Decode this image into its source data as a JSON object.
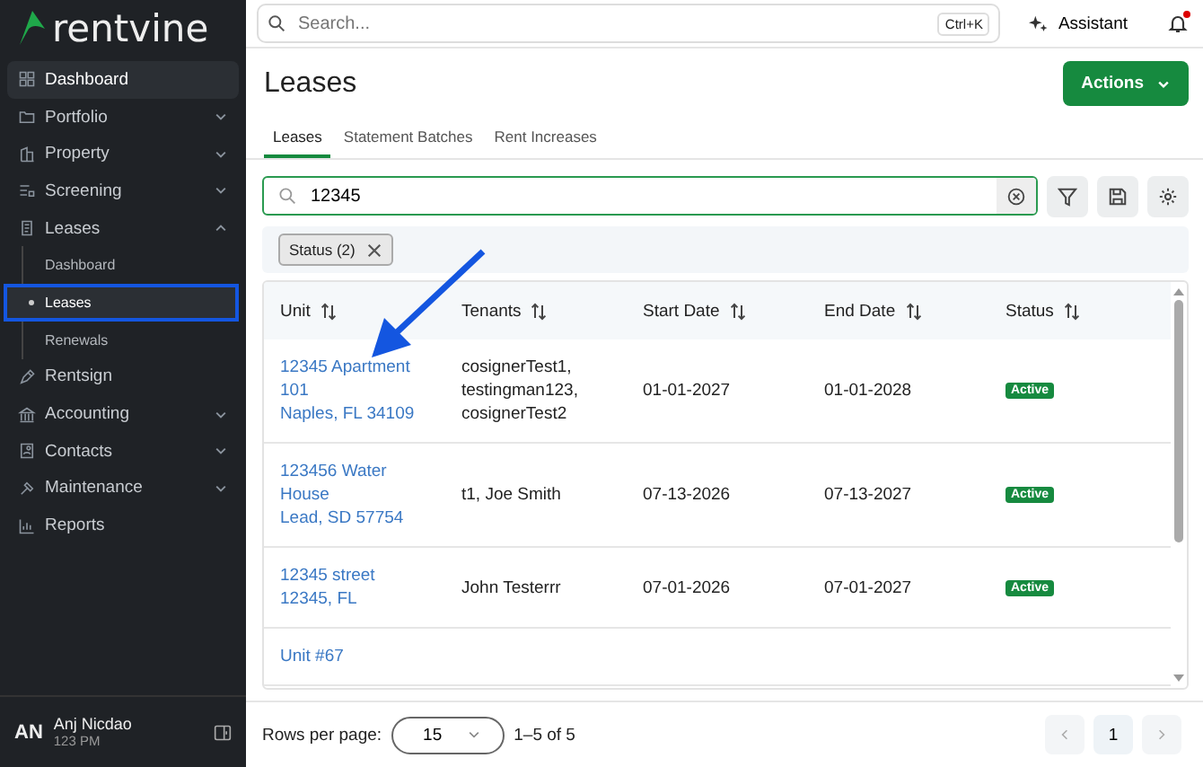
{
  "logo": "rentvine",
  "sidebar": {
    "items": [
      {
        "label": "Dashboard",
        "selected": true
      },
      {
        "label": "Portfolio",
        "selected": false,
        "expanded": false
      },
      {
        "label": "Property",
        "selected": false,
        "expanded": false
      },
      {
        "label": "Screening",
        "selected": false,
        "expanded": false
      },
      {
        "label": "Leases",
        "selected": false,
        "expanded": true,
        "children": [
          {
            "label": "Dashboard",
            "selected": false,
            "highlighted": false
          },
          {
            "label": "Leases",
            "selected": true,
            "highlighted": true
          },
          {
            "label": "Renewals",
            "selected": false,
            "highlighted": false
          }
        ]
      },
      {
        "label": "Rentsign",
        "selected": false
      },
      {
        "label": "Accounting",
        "selected": false,
        "expanded": false
      },
      {
        "label": "Contacts",
        "selected": false,
        "expanded": false
      },
      {
        "label": "Maintenance",
        "selected": false,
        "expanded": false
      },
      {
        "label": "Reports",
        "selected": false
      }
    ]
  },
  "user": {
    "initials": "AN",
    "name": "Anj Nicdao",
    "subtitle": "123 PM"
  },
  "topbar": {
    "search_placeholder": "Search...",
    "shortcut": "Ctrl+K",
    "assistant": "Assistant",
    "unread": true
  },
  "page": {
    "title": "Leases",
    "actions": "Actions"
  },
  "tabs": [
    {
      "label": "Leases",
      "selected": true
    },
    {
      "label": "Statement Batches",
      "selected": false
    },
    {
      "label": "Rent Increases",
      "selected": false
    }
  ],
  "search": {
    "value": "12345"
  },
  "filters": [
    {
      "label": "Status (2)"
    }
  ],
  "callout_arrow": true,
  "table": {
    "columns": [
      "Unit",
      "Tenants",
      "Start Date",
      "End Date",
      "Status"
    ],
    "rows": [
      {
        "unit": [
          "12345 Apartment",
          "101",
          "Naples, FL 34109"
        ],
        "tenants": [
          "cosignerTest1,",
          "testingman123,",
          "cosignerTest2"
        ],
        "start": "01-01-2027",
        "end": "01-01-2028",
        "status": "Active"
      },
      {
        "unit": [
          "123456 Water",
          "House",
          "Lead, SD 57754"
        ],
        "tenants": [
          "t1, Joe Smith"
        ],
        "start": "07-13-2026",
        "end": "07-13-2027",
        "status": "Active"
      },
      {
        "unit": [
          "12345 street",
          "12345, FL"
        ],
        "tenants": [
          "John Testerrr"
        ],
        "start": "07-01-2026",
        "end": "07-01-2027",
        "status": "Active"
      },
      {
        "unit": [
          "Unit #67"
        ],
        "tenants": []
      }
    ]
  },
  "footer": {
    "rows_label": "Rows per page:",
    "rows_value": "15",
    "range": "1–5 of 5",
    "page": "1"
  }
}
